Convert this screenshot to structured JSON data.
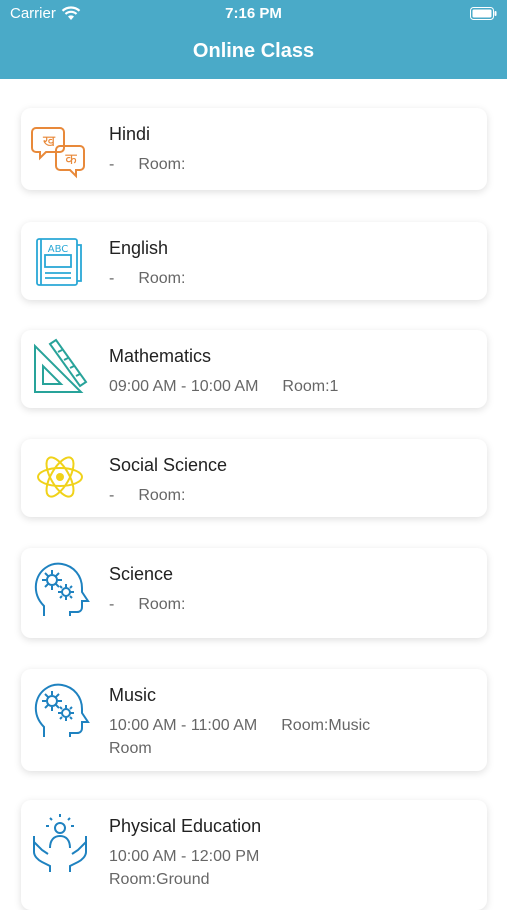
{
  "status_bar": {
    "carrier": "Carrier",
    "time": "7:16 PM"
  },
  "header": {
    "title": "Online Class"
  },
  "classes": [
    {
      "subject": "Hindi",
      "time": "-",
      "room": "Room:",
      "room2": "",
      "icon": "hindi-letters-icon",
      "color": "#e8893a"
    },
    {
      "subject": "English",
      "time": "-",
      "room": "Room:",
      "room2": "",
      "icon": "abc-book-icon",
      "color": "#2aa8d6"
    },
    {
      "subject": "Mathematics",
      "time": "09:00 AM - 10:00 AM",
      "room": "Room:1",
      "room2": "",
      "icon": "ruler-triangle-icon",
      "color": "#28a39a"
    },
    {
      "subject": "Social Science",
      "time": "-",
      "room": "Room:",
      "room2": "",
      "icon": "atom-icon",
      "color": "#f0d21a"
    },
    {
      "subject": "Science",
      "time": "-",
      "room": "Room:",
      "room2": "",
      "icon": "gear-head-icon",
      "color": "#1f82c0"
    },
    {
      "subject": "Music",
      "time": "10:00 AM - 11:00 AM",
      "room": "Room:Music",
      "room2": "Room",
      "icon": "gear-head-icon",
      "color": "#1f82c0"
    },
    {
      "subject": "Physical Education",
      "time": "10:00 AM - 12:00 PM",
      "room": "",
      "room2": "Room:Ground",
      "icon": "hands-person-icon",
      "color": "#1f82c0"
    }
  ],
  "colors": {
    "header_bg": "#4aaac8"
  }
}
